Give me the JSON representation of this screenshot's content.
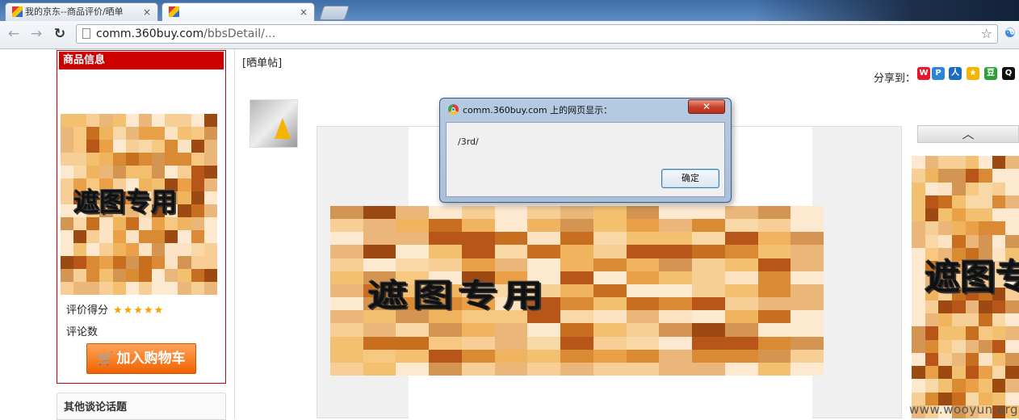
{
  "browser": {
    "tabs": [
      {
        "title": "我的京东--商品评价/晒单",
        "close": "×"
      },
      {
        "title": "",
        "close": "×"
      }
    ],
    "url_host": "comm.360buy.com",
    "url_path": "/bbsDetail/...",
    "icons": [
      "back-icon",
      "forward-icon",
      "reload-icon",
      "page-icon",
      "star-icon",
      "extension-icon"
    ]
  },
  "left_panel": {
    "header": "商品信息",
    "mask_text": "遮图专用",
    "rating_label": "评价得分",
    "rating_stars": "★★★★★",
    "review_label": "评论数",
    "cart_button": "加入购物车",
    "topics_header": "其他谈论话题"
  },
  "post": {
    "title": "[晒单帖]",
    "share_label": "分享到：",
    "share_icons": [
      "weibo-icon",
      "pengyou-icon",
      "renren-icon",
      "kaixin-icon",
      "douban-icon",
      "qq-icon"
    ],
    "mask_text": "遮图专用",
    "rail_arrow": "︿",
    "rail_mask_text": "遮图专"
  },
  "dialog": {
    "title": "comm.360buy.com 上的网页显示：",
    "message": "/3rd/",
    "ok_button": "确定",
    "close_button": "✕"
  },
  "watermark": "www.wooyun.org",
  "colors": {
    "accent_red": "#cc0000",
    "cart_orange": "#f06200",
    "mosaic": [
      "#fbe3c4",
      "#f9d8a8",
      "#f6c882",
      "#f0b45f",
      "#e9a046",
      "#d98a33",
      "#c86f1f",
      "#b8561a",
      "#f7cf96",
      "#fde9cf",
      "#eab67a",
      "#d49452",
      "#f3c070",
      "#9c4a12"
    ]
  }
}
